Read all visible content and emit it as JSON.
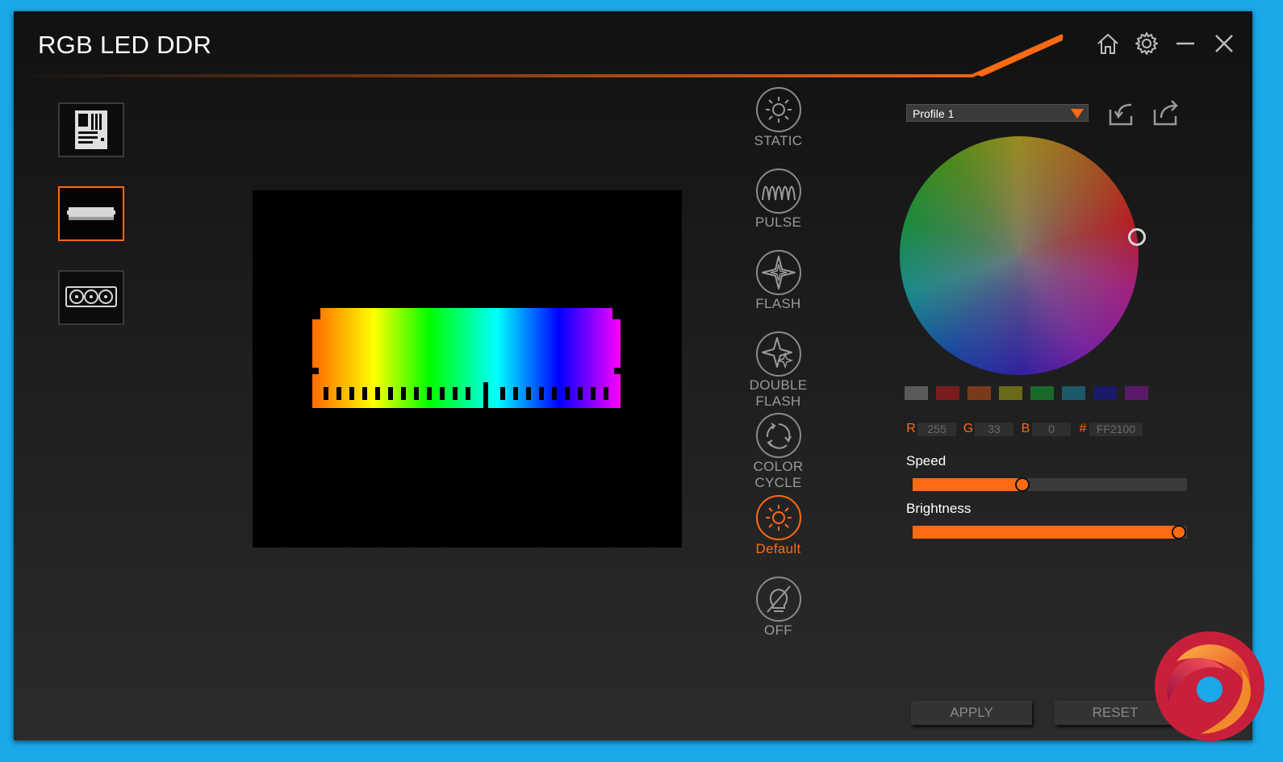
{
  "window": {
    "title": "RGB LED DDR"
  },
  "titlebar": {
    "icons": [
      "home-icon",
      "gear-icon",
      "minimize-icon",
      "close-icon"
    ]
  },
  "devices": [
    {
      "name": "motherboard",
      "icon": "motherboard-icon",
      "active": false
    },
    {
      "name": "memory",
      "icon": "ram-stick-icon",
      "active": true
    },
    {
      "name": "graphics-card",
      "icon": "graphics-card-icon",
      "active": false
    }
  ],
  "modes": {
    "static": "STATIC",
    "pulse": "PULSE",
    "flash": "FLASH",
    "double_flash_1": "DOUBLE",
    "double_flash_2": "FLASH",
    "color_cycle_1": "COLOR",
    "color_cycle_2": "CYCLE",
    "default": "Default",
    "off": "OFF",
    "selected": "Default"
  },
  "profile": {
    "selected": "Profile 1"
  },
  "color": {
    "swatches": [
      "#5a5a5a",
      "#7a1c1c",
      "#7a3a1a",
      "#6a6a1a",
      "#1a6a2a",
      "#1a5a6a",
      "#1a1a6a",
      "#5a1a6a"
    ],
    "r_label": "R",
    "r": "255",
    "g_label": "G",
    "g": "33",
    "b_label": "B",
    "b": "0",
    "hex_label": "#",
    "hex": "FF2100"
  },
  "speed": {
    "label": "Speed",
    "value_fraction": 0.4
  },
  "brightness": {
    "label": "Brightness",
    "value_fraction": 0.97
  },
  "buttons": {
    "apply": "APPLY",
    "reset": "RESET"
  },
  "accent_color": "#ff6a13"
}
